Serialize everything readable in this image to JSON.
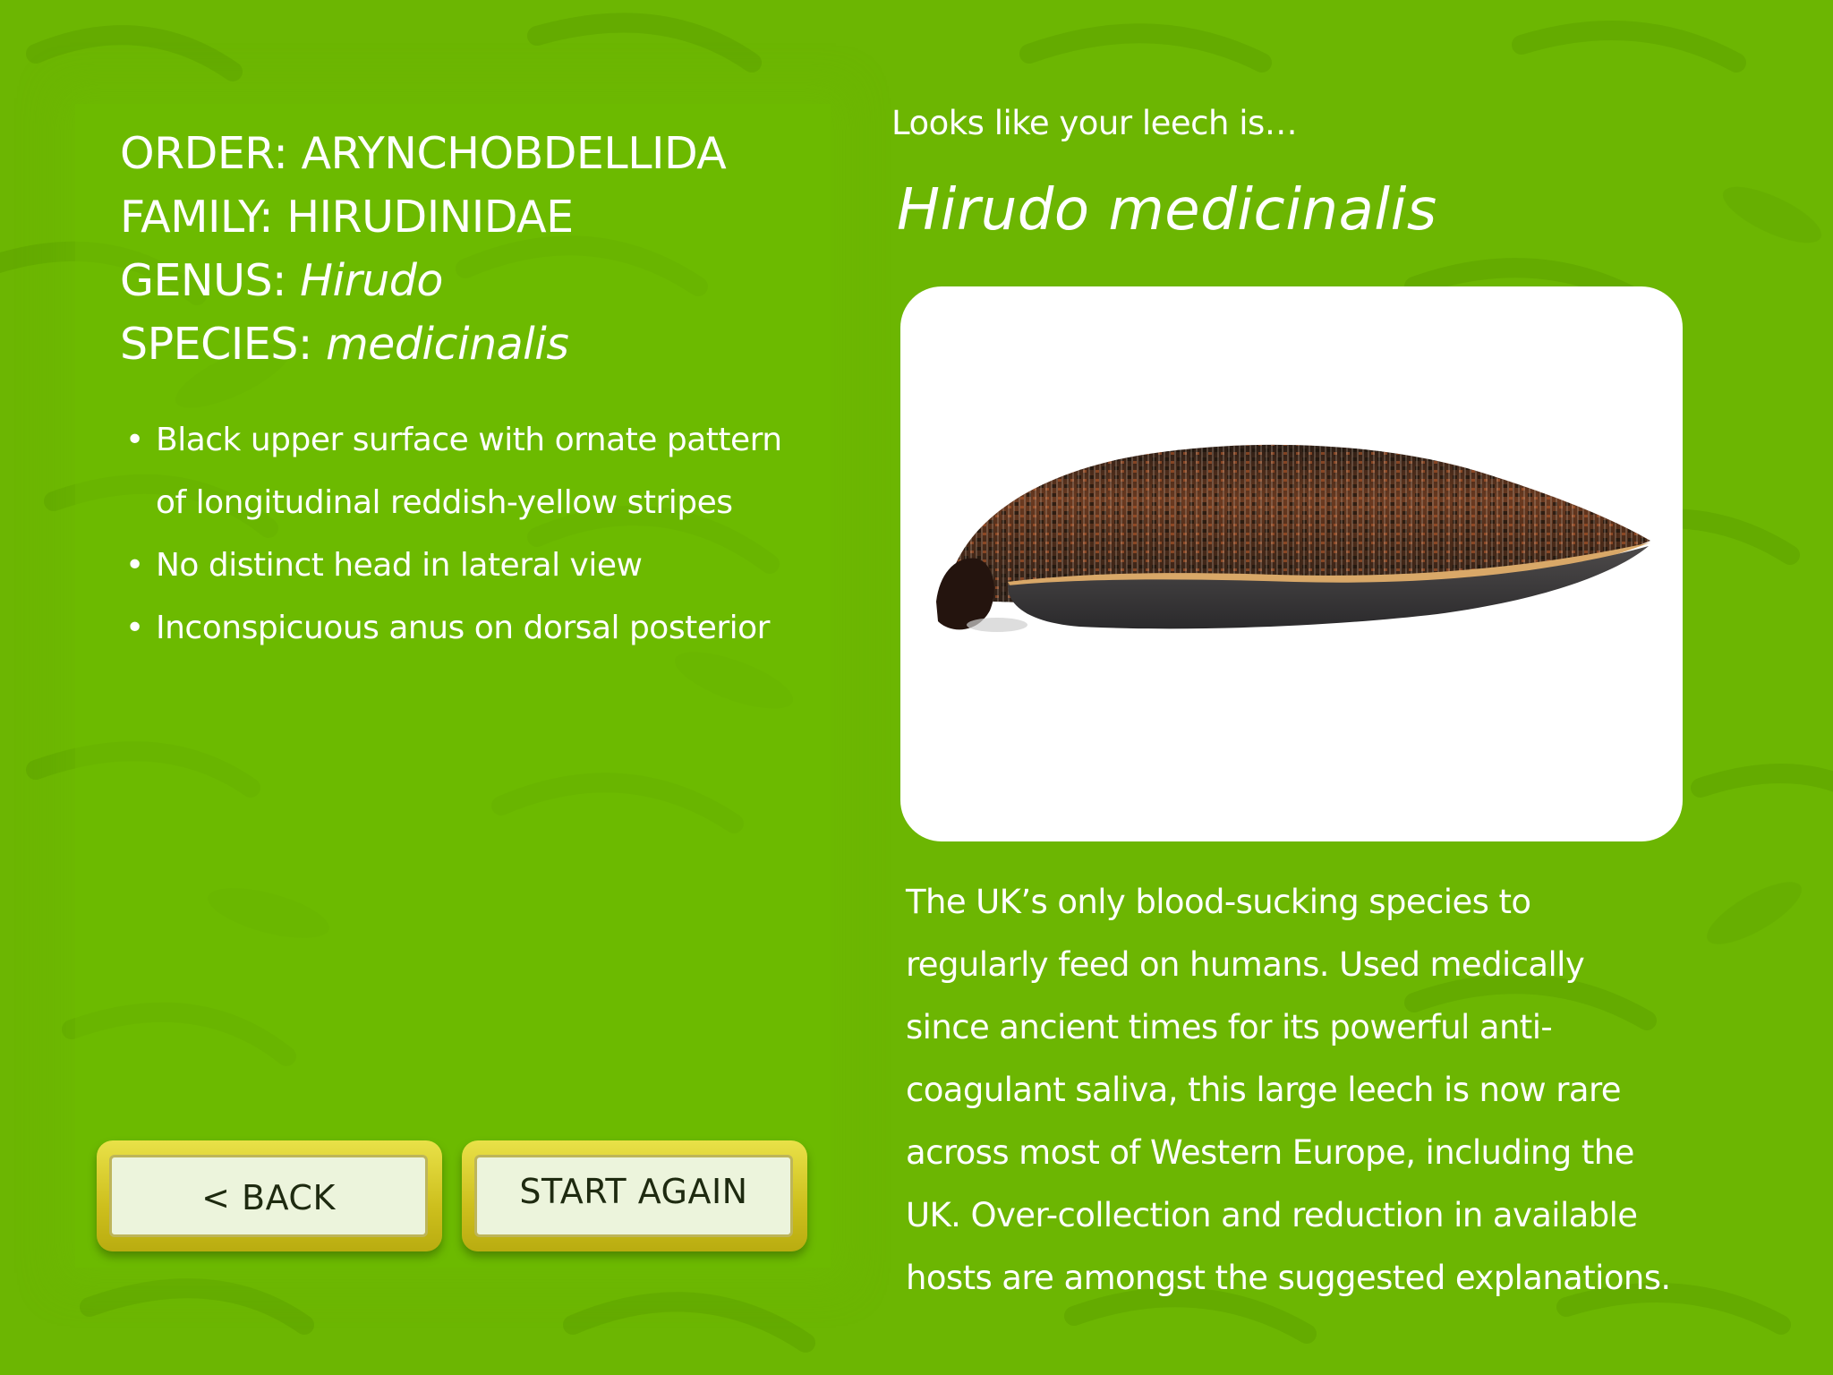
{
  "taxonomy": {
    "order_label": "ORDER:",
    "order_value": "ARYNCHOBDELLIDA",
    "family_label": "FAMILY:",
    "family_value": "HIRUDINIDAE",
    "genus_label": "GENUS:",
    "genus_value": "Hirudo",
    "species_label": "SPECIES:",
    "species_value": "medicinalis"
  },
  "features": [
    {
      "bullet": "•",
      "text": "Black upper surface with ornate pattern of longitudinal reddish-yellow stripes"
    },
    {
      "bullet": "•",
      "text": "No distinct head in lateral view"
    },
    {
      "bullet": "•",
      "text": "Inconspicuous anus on dorsal posterior"
    }
  ],
  "buttons": {
    "back_label": "< BACK",
    "start_again_label": "START AGAIN"
  },
  "result": {
    "kicker": "Looks like your leech is…",
    "species_name": "Hirudo medicinalis",
    "description": "The UK’s only blood-sucking species to regularly feed on humans. Used medically since ancient times for its powerful anti-coagulant saliva, this large leech is now rare across most of Western Europe, including the UK. Over-collection and reduction in available hosts are amongst the suggested explanations."
  },
  "colors": {
    "background": "#6cb602",
    "button_gold": "#cdbf1d",
    "button_face": "#ecf4dc",
    "card": "#ffffff"
  },
  "icons": {
    "background_motif": "leech-silhouette-pattern",
    "photo": "leech-photo-hirudo-medicinalis"
  }
}
